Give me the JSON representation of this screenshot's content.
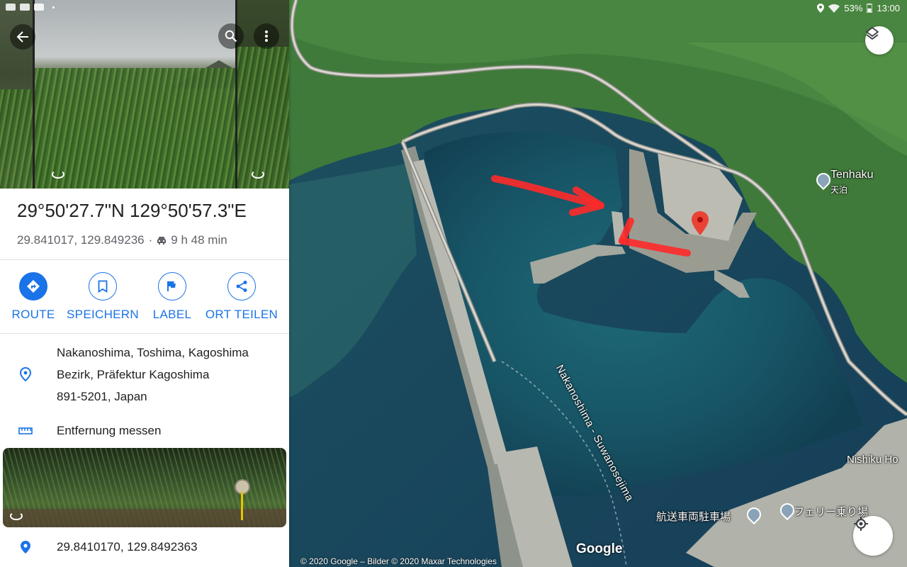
{
  "status_bar": {
    "battery": "53%",
    "time": "13:00"
  },
  "place": {
    "title": "29°50'27.7\"N 129°50'57.3\"E",
    "decimal": "29.841017, 129.849236",
    "separator": "·",
    "drive_time": "9 h 48 min"
  },
  "actions": [
    {
      "label": "ROUTE",
      "icon": "directions-icon"
    },
    {
      "label": "SPEICHERN",
      "icon": "bookmark-icon"
    },
    {
      "label": "LABEL",
      "icon": "flag-icon"
    },
    {
      "label": "ORT TEILEN",
      "icon": "share-icon"
    }
  ],
  "address": {
    "line1": "Nakanoshima, Toshima, Kagoshima",
    "line2": "Bezirk, Präfektur Kagoshima",
    "line3": "891-5201, Japan"
  },
  "measure_label": "Entfernung messen",
  "plus_code": "29.8410170, 129.8492363",
  "map": {
    "labels": {
      "tenhaku": "Tenhaku",
      "tenhaku_jp": "天泊",
      "ferry_route": "Nakanoshima - Suwanosejima",
      "nishiku": "Nishiku Ho",
      "parking": "航送車両駐車場",
      "ferry": "フェリー乗り場"
    },
    "google": "Google",
    "copyright": "© 2020 Google – Bilder © 2020 Maxar Technologies"
  },
  "colors": {
    "accent": "#1a73e8",
    "pin": "#ea4335",
    "annotation": "#ff2a2a"
  }
}
